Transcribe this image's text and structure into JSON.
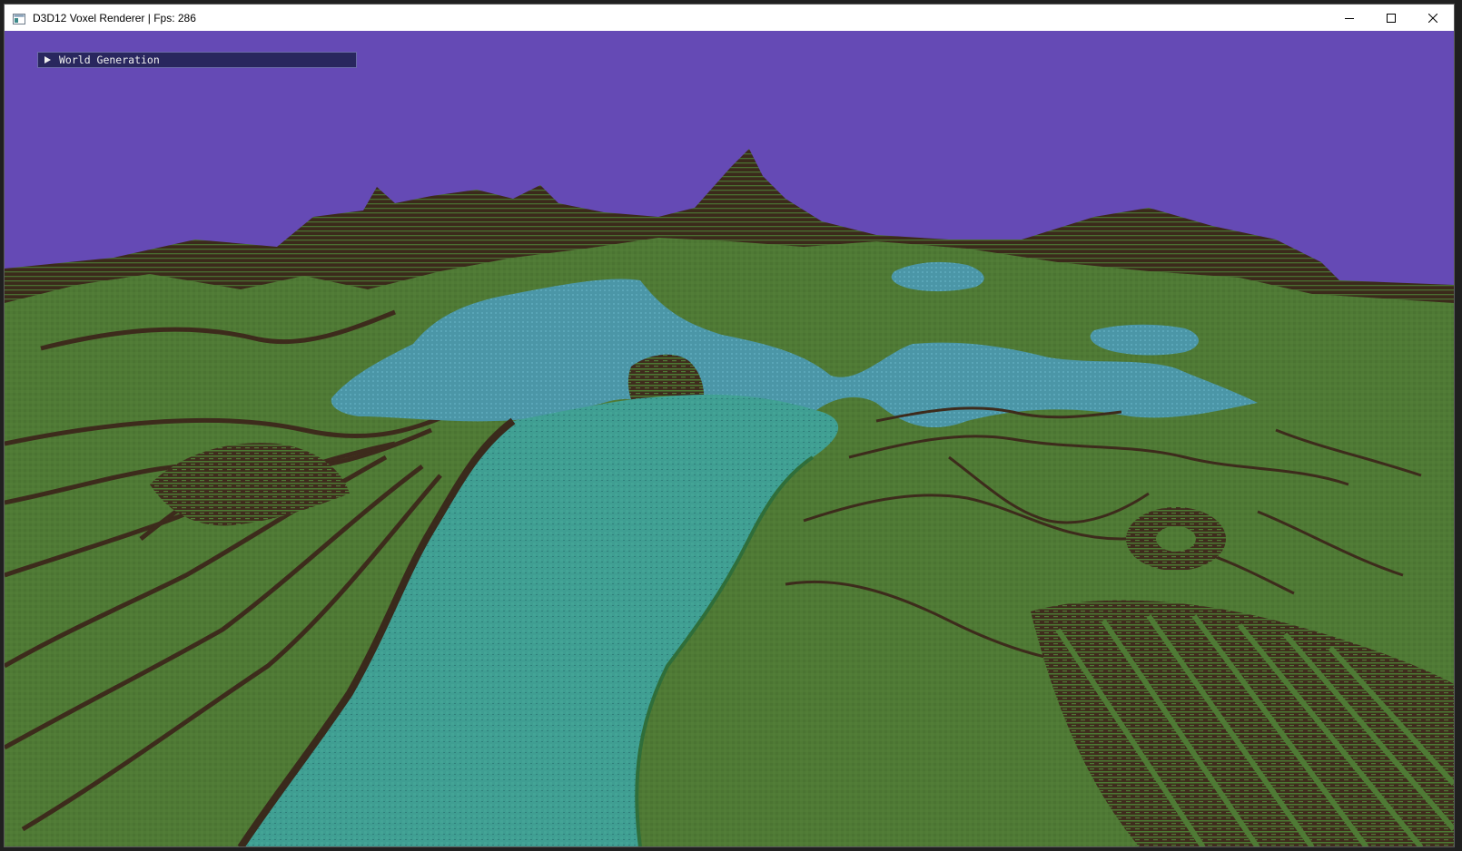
{
  "window": {
    "title": "D3D12 Voxel Renderer | Fps: 286",
    "icon": "app-window-icon",
    "controls": [
      "minimize-icon",
      "maximize-icon",
      "close-icon"
    ]
  },
  "overlay": {
    "collapsing_header_label": "World Generation",
    "collapsed": true
  },
  "scene": {
    "sky_color": "#654ab5",
    "grass_color": "#4f7a35",
    "dirt_color": "#3d2b1c",
    "water_color": "#3f9e92"
  }
}
